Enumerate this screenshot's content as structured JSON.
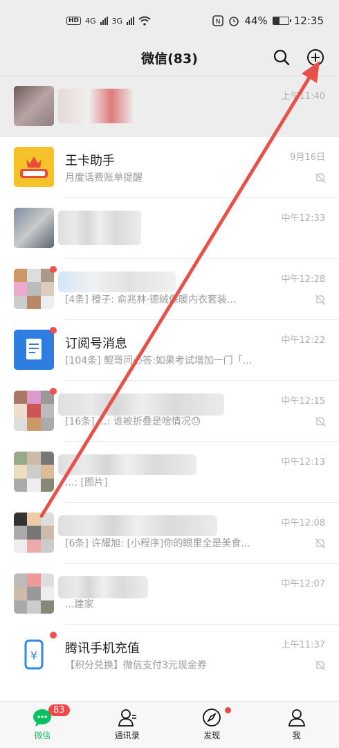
{
  "status_bar": {
    "hd": "HD",
    "net1": "4G",
    "net2": "3G",
    "battery_percent": "44%",
    "battery_level": 0.44,
    "time": "12:35"
  },
  "header": {
    "title": "微信(83)",
    "search_icon": "search-icon",
    "add_icon": "plus-circle-icon"
  },
  "chats": [
    {
      "name": "",
      "preview": "",
      "time": "上午11:40",
      "pinned": true,
      "muted": false,
      "dot": false,
      "obscured": true
    },
    {
      "name": "王卡助手",
      "preview": "月度话费账单提醒",
      "time": "9月16日",
      "muted": true,
      "dot": false
    },
    {
      "name": "",
      "preview": "",
      "time": "中午12:33",
      "muted": false,
      "dot": false,
      "obscured": true
    },
    {
      "name": "",
      "preview": "[4条] 橙子: 俞兆林·德绒保暖内衣套装...",
      "time": "中午12:28",
      "muted": true,
      "dot": true,
      "obscured": true
    },
    {
      "name": "订阅号消息",
      "preview": "[104条] 鲲哥问必答:如果考试增加一门「...",
      "time": "中午12:22",
      "muted": false,
      "dot": true
    },
    {
      "name": "",
      "preview": "[16条] ...: 谁被折叠是啥情况😓",
      "time": "中午12:15",
      "muted": true,
      "dot": true,
      "obscured": true
    },
    {
      "name": "",
      "preview": "...: [图片]",
      "time": "中午12:13",
      "muted": false,
      "dot": false,
      "obscured": true
    },
    {
      "name": "",
      "preview": "[6条] 许耀旭: [小程序]你的眼里全是美食...",
      "time": "中午12:08",
      "muted": true,
      "dot": false,
      "obscured": true
    },
    {
      "name": "",
      "preview": "...建家",
      "time": "中午12:07",
      "muted": false,
      "dot": false,
      "obscured": true
    },
    {
      "name": "腾讯手机充值",
      "preview": "【积分兑换】微信支付3元现金券",
      "time": "上午11:37",
      "muted": true,
      "dot": true
    }
  ],
  "tabs": [
    {
      "label": "微信",
      "icon": "chat-bubble-icon",
      "badge": "83",
      "active": true
    },
    {
      "label": "通讯录",
      "icon": "contacts-icon"
    },
    {
      "label": "发现",
      "icon": "compass-icon",
      "dot": true
    },
    {
      "label": "我",
      "icon": "person-icon"
    }
  ],
  "colors": {
    "accent": "#07c160",
    "badge": "#f04848",
    "arrow": "#e8504a"
  }
}
